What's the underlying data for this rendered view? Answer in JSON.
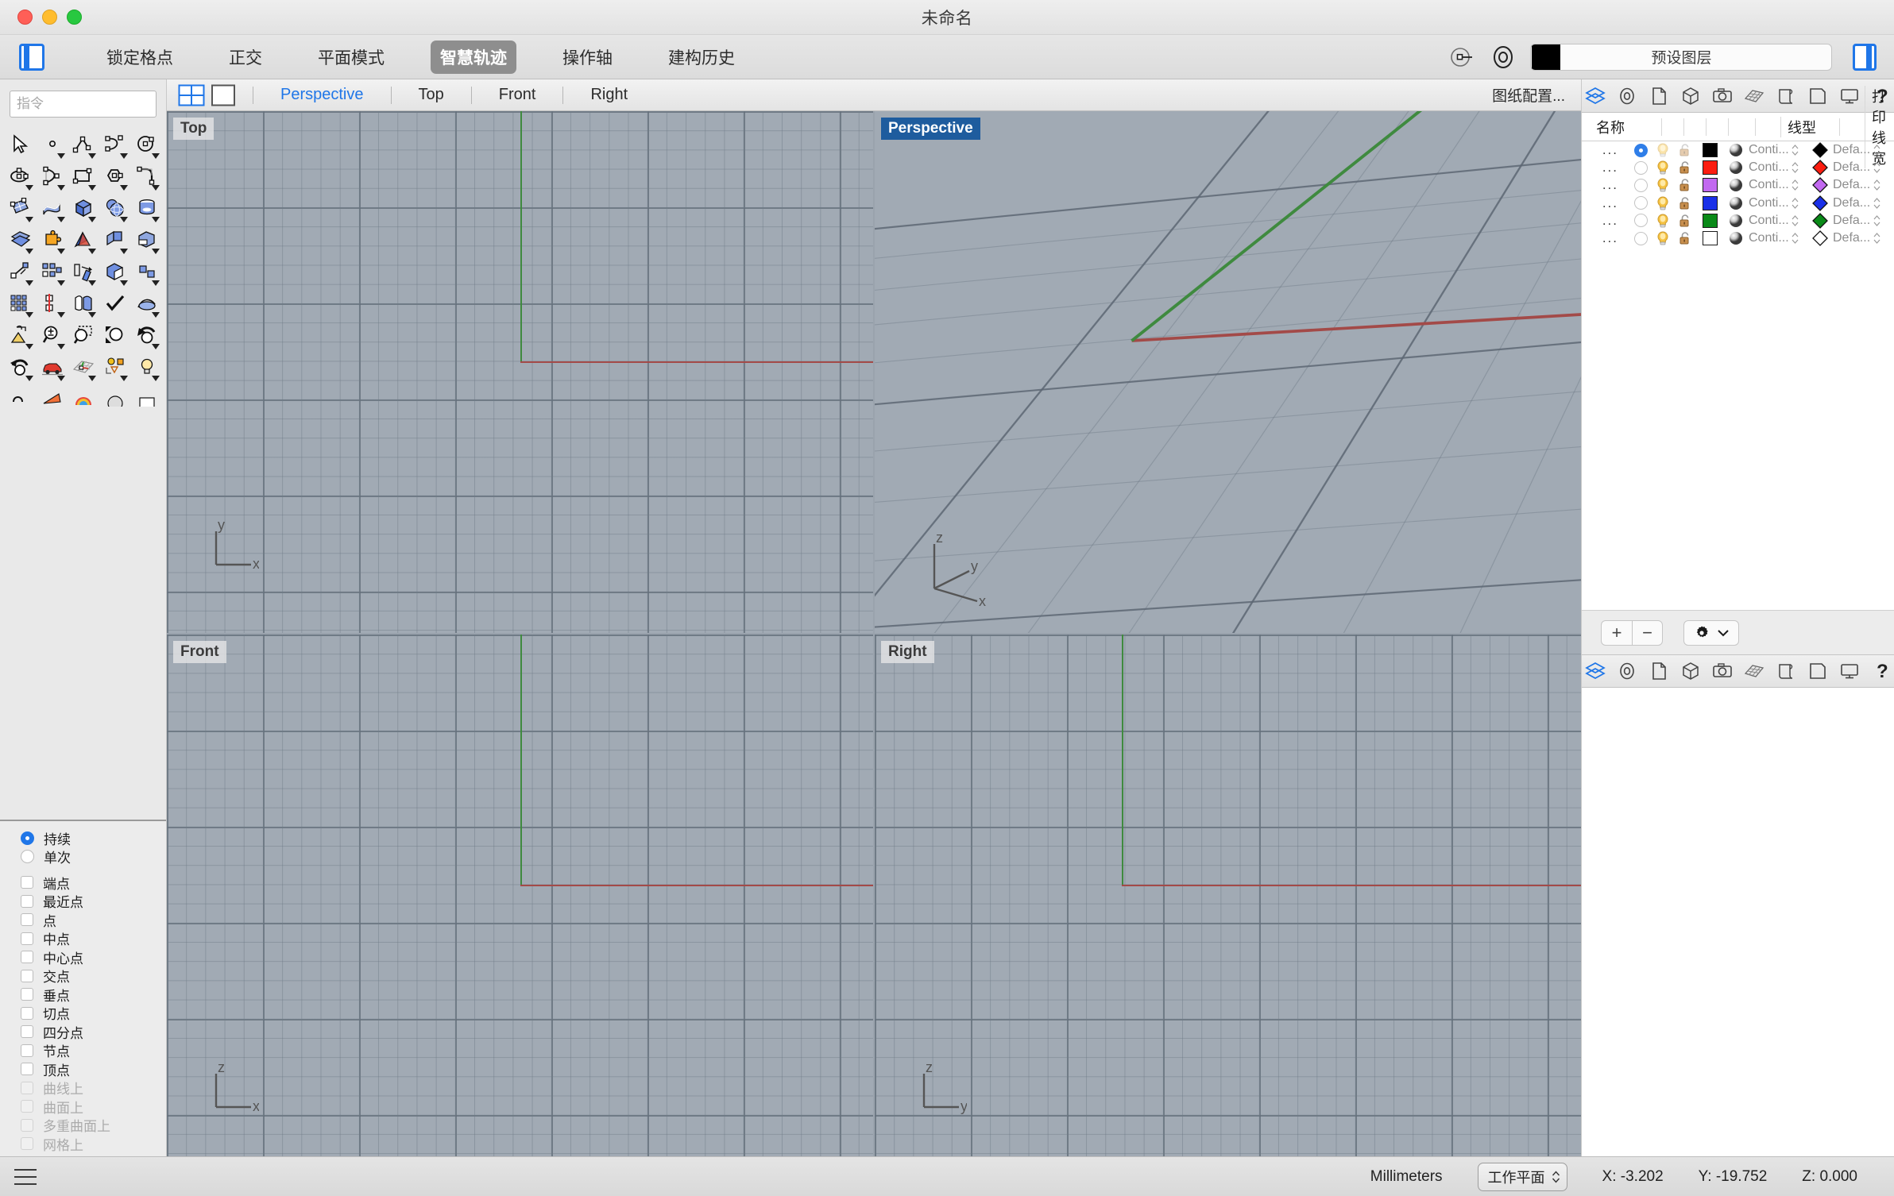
{
  "window": {
    "title": "未命名"
  },
  "toolbar": {
    "panel_toggle": "panel-toggle",
    "items": [
      {
        "label": "锁定格点",
        "active": false
      },
      {
        "label": "正交",
        "active": false
      },
      {
        "label": "平面模式",
        "active": false
      },
      {
        "label": "智慧轨迹",
        "active": true
      },
      {
        "label": "操作轴",
        "active": false
      },
      {
        "label": "建构历史",
        "active": false
      }
    ],
    "layer_combo": {
      "label": "预设图层",
      "color": "#000000"
    }
  },
  "sidebar": {
    "command_input": {
      "value": "",
      "placeholder": "指令"
    },
    "snap_mode": [
      {
        "label": "持续",
        "selected": true
      },
      {
        "label": "单次",
        "selected": false
      }
    ],
    "snaps": [
      {
        "label": "端点",
        "checked": false,
        "disabled": false
      },
      {
        "label": "最近点",
        "checked": false,
        "disabled": false
      },
      {
        "label": "点",
        "checked": false,
        "disabled": false
      },
      {
        "label": "中点",
        "checked": false,
        "disabled": false
      },
      {
        "label": "中心点",
        "checked": false,
        "disabled": false
      },
      {
        "label": "交点",
        "checked": false,
        "disabled": false
      },
      {
        "label": "垂点",
        "checked": false,
        "disabled": false
      },
      {
        "label": "切点",
        "checked": false,
        "disabled": false
      },
      {
        "label": "四分点",
        "checked": false,
        "disabled": false
      },
      {
        "label": "节点",
        "checked": false,
        "disabled": false
      },
      {
        "label": "顶点",
        "checked": false,
        "disabled": false
      },
      {
        "label": "曲线上",
        "checked": false,
        "disabled": true
      },
      {
        "label": "曲面上",
        "checked": false,
        "disabled": true
      },
      {
        "label": "多重曲面上",
        "checked": false,
        "disabled": true
      },
      {
        "label": "网格上",
        "checked": false,
        "disabled": true
      }
    ]
  },
  "viewports": {
    "tabs": [
      {
        "label": "Perspective",
        "active": true
      },
      {
        "label": "Top",
        "active": false
      },
      {
        "label": "Front",
        "active": false
      },
      {
        "label": "Right",
        "active": false
      }
    ],
    "config_label": "图纸配置...",
    "panes": [
      {
        "label": "Top",
        "active": false,
        "axes": [
          "y",
          "x"
        ]
      },
      {
        "label": "Perspective",
        "active": true,
        "axes": [
          "z",
          "y",
          "x"
        ]
      },
      {
        "label": "Front",
        "active": false,
        "axes": [
          "z",
          "x"
        ]
      },
      {
        "label": "Right",
        "active": false,
        "axes": [
          "z",
          "y"
        ]
      }
    ]
  },
  "layers_panel": {
    "columns": [
      "名称",
      "线型",
      "打印线宽"
    ],
    "rows": [
      {
        "name": "...",
        "current": true,
        "visible": true,
        "unlocked": true,
        "color": "#000000",
        "linetype": "Conti...",
        "print_color": "#000000",
        "print_width": "Defa...",
        "dimmed": true
      },
      {
        "name": "...",
        "current": false,
        "visible": true,
        "unlocked": true,
        "color": "#fc1d10",
        "linetype": "Conti...",
        "print_color": "#fc1d10",
        "print_width": "Defa...",
        "dimmed": false
      },
      {
        "name": "...",
        "current": false,
        "visible": true,
        "unlocked": true,
        "color": "#c269f0",
        "linetype": "Conti...",
        "print_color": "#c269f0",
        "print_width": "Defa...",
        "dimmed": false
      },
      {
        "name": "...",
        "current": false,
        "visible": true,
        "unlocked": true,
        "color": "#1a30e8",
        "linetype": "Conti...",
        "print_color": "#1a30e8",
        "print_width": "Defa...",
        "dimmed": false
      },
      {
        "name": "...",
        "current": false,
        "visible": true,
        "unlocked": true,
        "color": "#0a8a18",
        "linetype": "Conti...",
        "print_color": "#0a8a18",
        "print_width": "Defa...",
        "dimmed": false
      },
      {
        "name": "...",
        "current": false,
        "visible": true,
        "unlocked": true,
        "color": "#ffffff",
        "linetype": "Conti...",
        "print_color": "#ffffff",
        "print_width": "Defa...",
        "dimmed": false
      }
    ],
    "footer": {
      "add_label": "+",
      "remove_label": "−"
    },
    "icon_tabs": [
      "layers-icon",
      "osnap-icon",
      "document-icon",
      "object-props-icon",
      "camera-icon",
      "render-mesh-icon",
      "notes-icon",
      "page-icon",
      "display-icon",
      "help-icon"
    ]
  },
  "status_bar": {
    "units": "Millimeters",
    "cplane": "工作平面",
    "x": "X: -3.202",
    "y": "Y: -19.752",
    "z": "Z: 0.000"
  }
}
